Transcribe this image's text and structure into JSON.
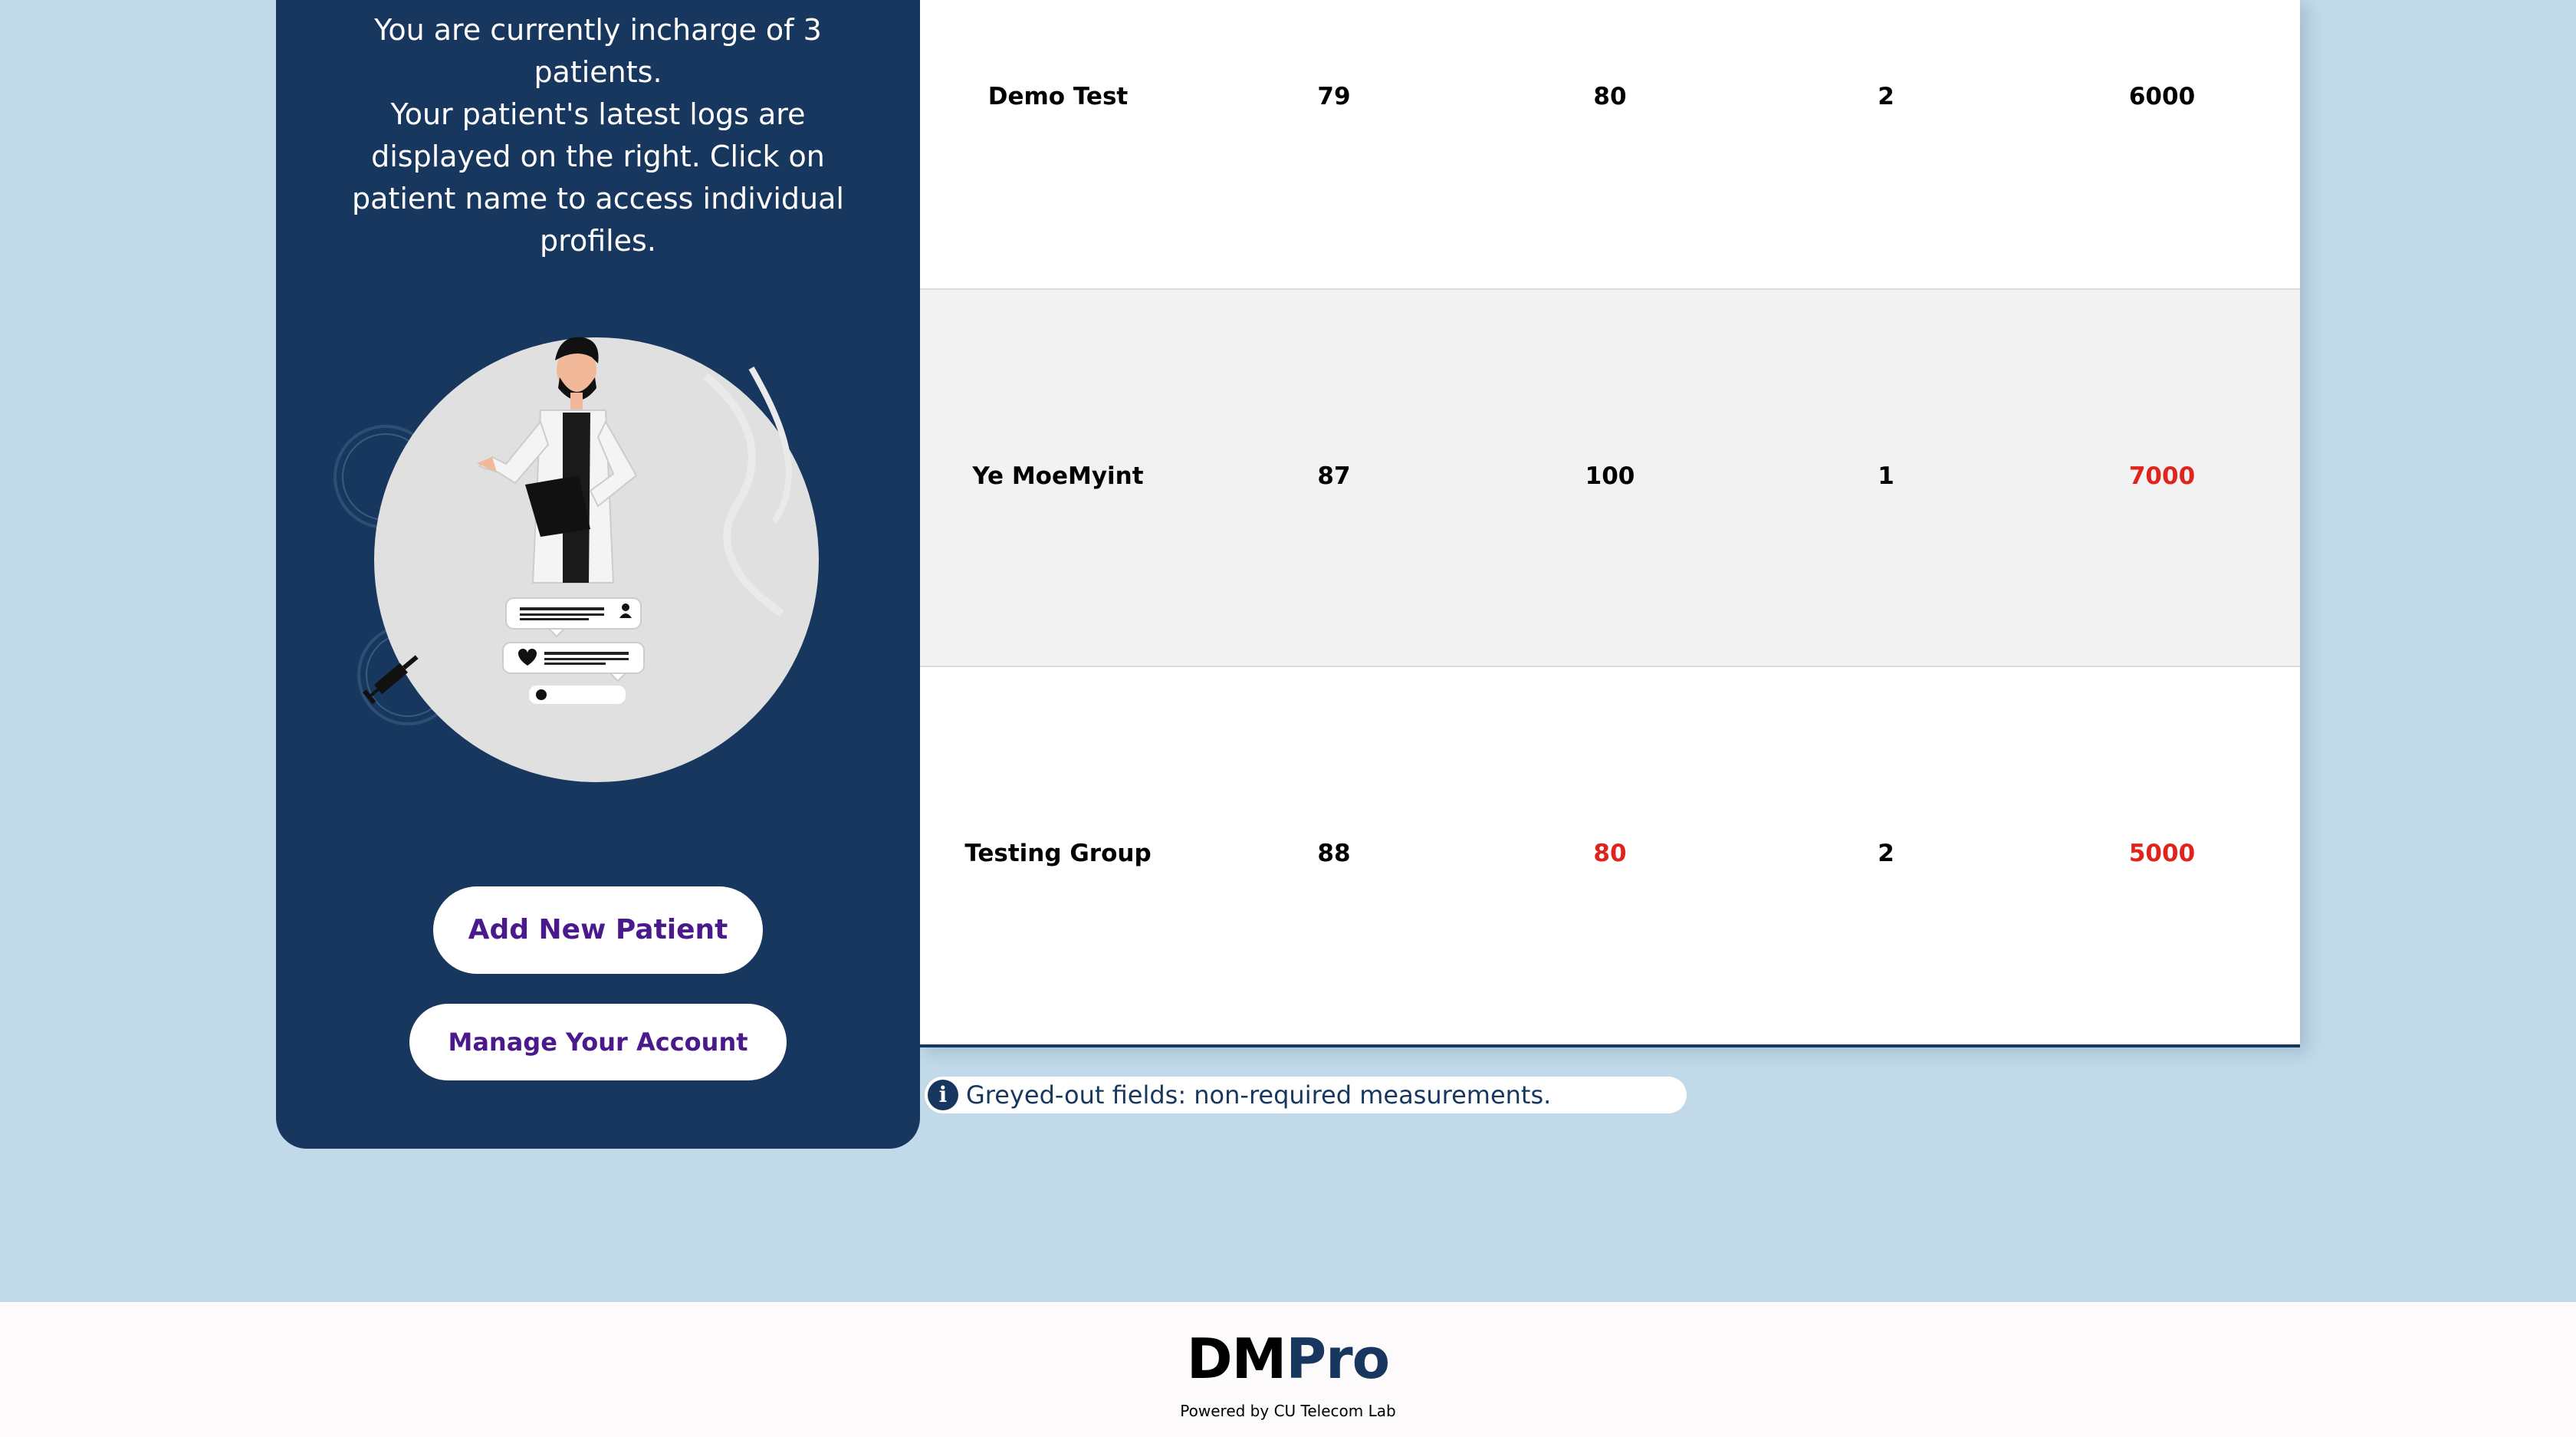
{
  "sidebar": {
    "intro_line1": "You are currently incharge of 3 patients.",
    "intro_line2": "Your patient's latest logs are displayed on the right. Click on patient name to access individual profiles.",
    "add_button": "Add New Patient",
    "manage_button": "Manage Your Account"
  },
  "table": {
    "rows": [
      {
        "name": "Demo Test",
        "v1": "79",
        "v2": "80",
        "v3": "2",
        "v4": "6000"
      },
      {
        "name": "Ye MoeMyint",
        "v1": "87",
        "v2": "100",
        "v3": "1",
        "v4": "7000"
      },
      {
        "name": "Testing Group",
        "v1": "88",
        "v2": "80",
        "v3": "2",
        "v4": "5000"
      }
    ],
    "flagged_color": "#e0231c"
  },
  "info_note": "Greyed-out fields: non-required measurements.",
  "footer": {
    "brand_dm": "DM",
    "brand_pro": "Pro",
    "powered_by": "Powered by CU Telecom Lab"
  },
  "colors": {
    "navy": "#17375e",
    "background": "#c1d9e8",
    "button_text": "#4a1a8c"
  }
}
